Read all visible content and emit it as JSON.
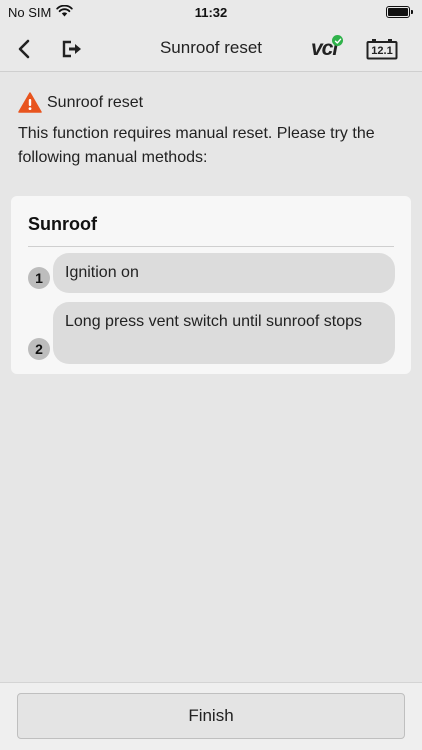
{
  "status_bar": {
    "carrier": "No SIM",
    "time": "11:32",
    "wifi_icon": "wifi-icon",
    "battery_icon": "battery-icon"
  },
  "nav": {
    "title": "Sunroof reset",
    "back_icon": "chevron-left-icon",
    "exit_icon": "exit-icon",
    "vci_label": "vci",
    "vci_status_color": "#2fb24a",
    "battery_voltage": "12.1"
  },
  "warning": {
    "icon": "warning-icon",
    "icon_color": "#e8541e",
    "title": "Sunroof reset",
    "message": "This function requires manual reset. Please try the following manual methods:"
  },
  "card": {
    "title": "Sunroof",
    "steps": [
      {
        "number": "1",
        "text": "Ignition on"
      },
      {
        "number": "2",
        "text": "Long press vent switch until sunroof stops"
      }
    ]
  },
  "footer": {
    "finish_label": "Finish"
  }
}
